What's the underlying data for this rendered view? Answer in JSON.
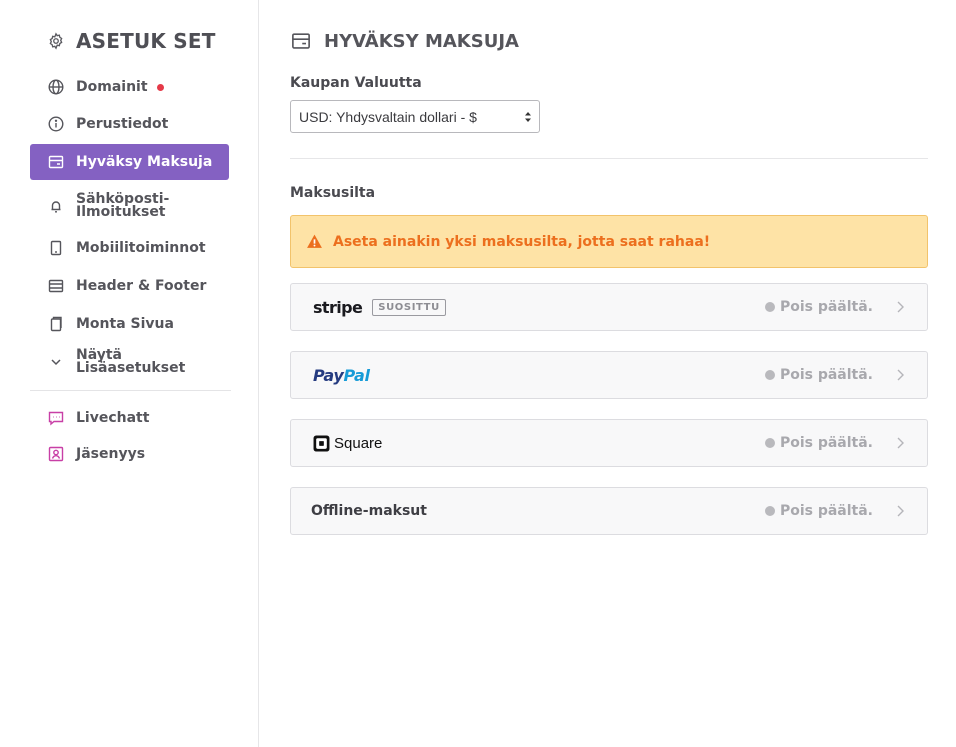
{
  "sidebar": {
    "title": "ASETUK SET",
    "items": [
      {
        "label": "Domainit"
      },
      {
        "label": "Perustiedot"
      },
      {
        "label": "Hyväksy Maksuja"
      },
      {
        "label": "Sähköposti-\nIlmoitukset"
      },
      {
        "label": "Mobiilitoiminnot"
      },
      {
        "label": "Header & Footer"
      },
      {
        "label": "Monta Sivua"
      },
      {
        "label": "Näytä Lisäasetukset"
      }
    ],
    "extra_items": [
      {
        "label": "Livechatt"
      },
      {
        "label": "Jäsenyys"
      }
    ]
  },
  "main": {
    "title": "HYVÄKSY MAKSUJA",
    "currency_label": "Kaupan Valuutta",
    "currency_value": "USD: Yhdysvaltain dollari - $",
    "gateways_label": "Maksusilta",
    "alert_text": "Aseta ainakin yksi maksusilta, jotta saat rahaa!",
    "gateways": [
      {
        "name": "stripe",
        "badge": "SUOSITTU",
        "status": "Pois päältä."
      },
      {
        "name_part1": "Pay",
        "name_part2": "Pal",
        "status": "Pois päältä."
      },
      {
        "name": "Square",
        "status": "Pois päältä."
      },
      {
        "name": "Offline-maksut",
        "status": "Pois päältä."
      }
    ]
  },
  "colors": {
    "accent": "#8461c2",
    "alert_bg": "#fee3a6",
    "alert_text": "#ec6f1e",
    "notification_dot": "#e53948",
    "paypal_dark": "#253b80",
    "paypal_light": "#179bd7",
    "extension_icons": "#c83fa6"
  }
}
